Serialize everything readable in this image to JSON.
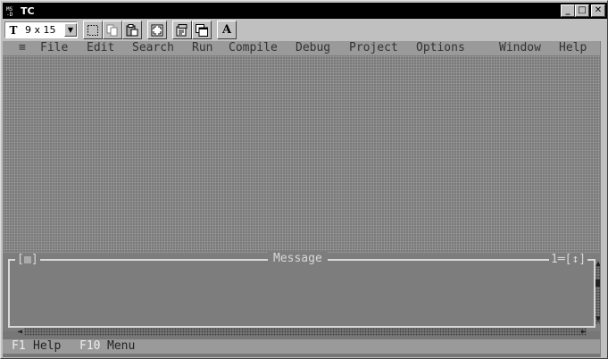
{
  "window": {
    "title": "TC",
    "minimize": "_",
    "maximize": "□",
    "close": "✕"
  },
  "toolbar": {
    "font_icon": "T",
    "font_size": "9 x 15",
    "dropdown_arrow": "▼",
    "font_button_label": "A"
  },
  "ide": {
    "system_menu": "≡",
    "menu": [
      "File",
      "Edit",
      "Search",
      "Run",
      "Compile",
      "Debug",
      "Project",
      "Options",
      "Window",
      "Help"
    ],
    "message_window": {
      "title": "Message",
      "window_number": "1═[↕]"
    },
    "status": {
      "f1_key": "F1",
      "f1_label": "Help",
      "f10_key": "F10",
      "f10_label": "Menu"
    }
  }
}
